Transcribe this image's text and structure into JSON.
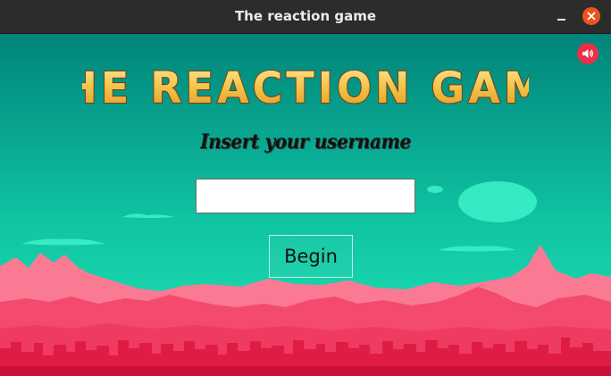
{
  "window": {
    "title": "The reaction game"
  },
  "game": {
    "title": "THE REACTION GAME",
    "prompt": "Insert your username",
    "username_value": "",
    "begin_label": "Begin"
  },
  "icons": {
    "sound": "speaker-volume-icon",
    "minimize": "minimize-icon",
    "close": "close-icon"
  },
  "colors": {
    "sky_top": "#00847a",
    "sky_bottom": "#22e6b8",
    "mountain_back": "#fb7a93",
    "mountain_mid": "#f44a6e",
    "city": "#df1c44",
    "title_gold": "#f2c246",
    "sound_button": "#e8304a",
    "close_button": "#e95420"
  }
}
